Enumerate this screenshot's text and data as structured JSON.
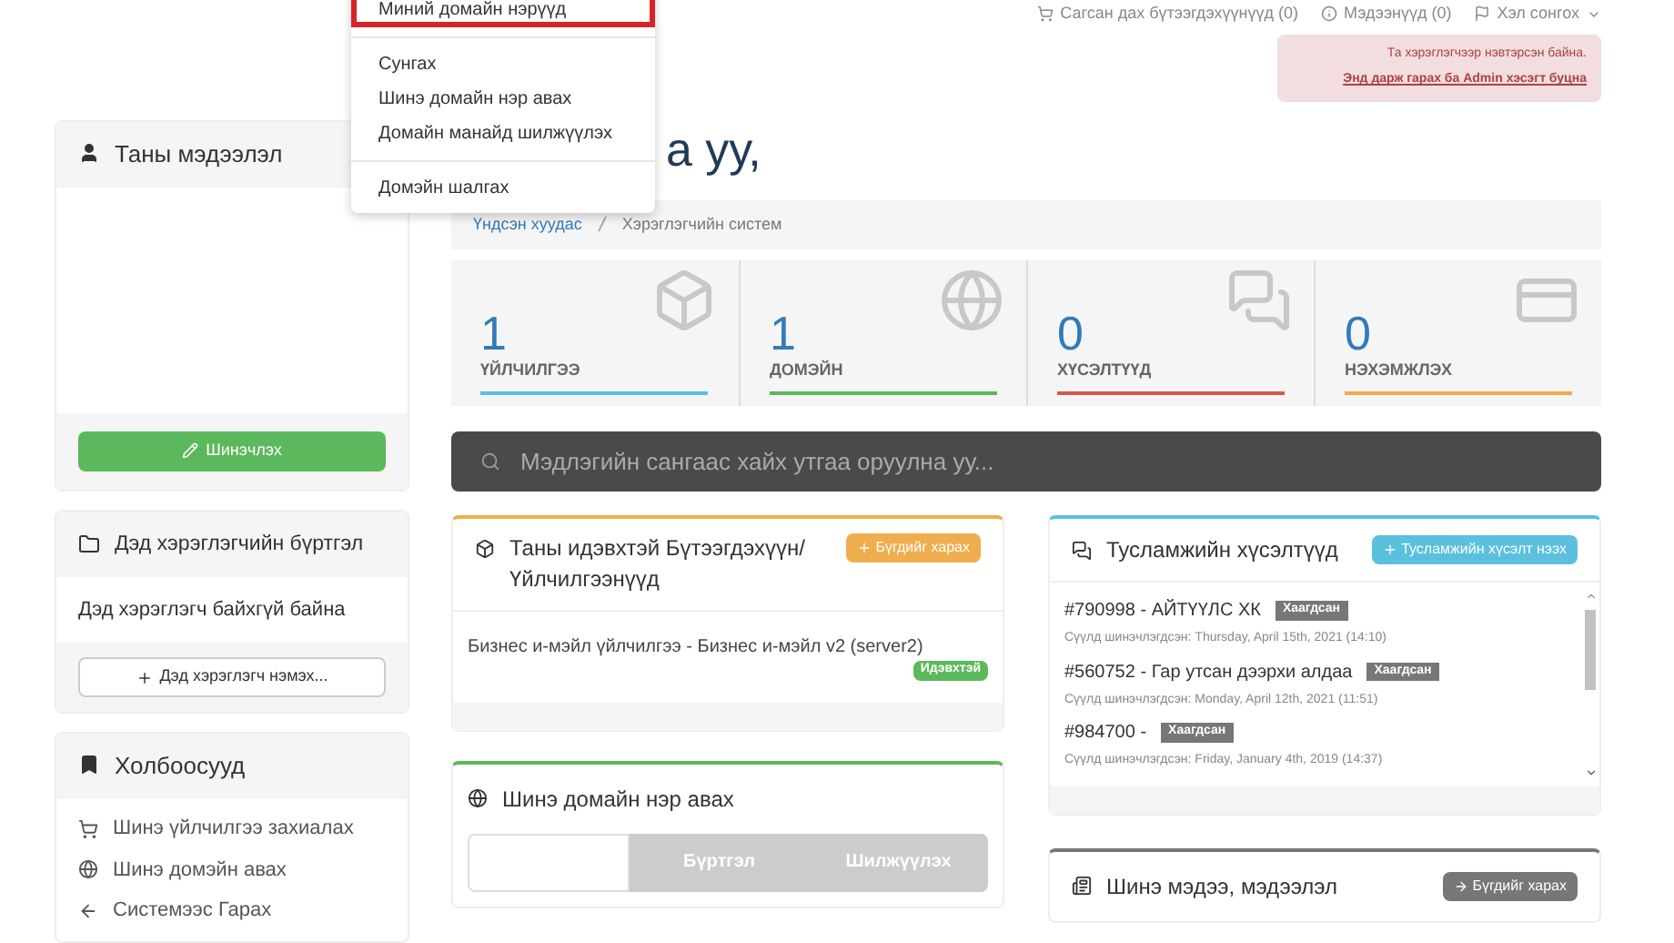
{
  "top_nav": [
    {
      "label": "Сагсан дах бүтээгдэхүүнүүд (0)"
    },
    {
      "label": "Мэдээнүүд (0)"
    },
    {
      "label": "Хэл сонгох"
    }
  ],
  "alert": {
    "message": "Та хэрэглэгчээр нэвтэрсэн байна.",
    "link": "Энд дарж гарах ба Admin хэсэгт буцна"
  },
  "dropdown": {
    "items": [
      {
        "kind": "item",
        "label": "Миний домайн нэрүүд",
        "highlighted": true
      },
      {
        "kind": "divider"
      },
      {
        "kind": "item",
        "label": "Сунгах",
        "highlighted": false
      },
      {
        "kind": "item",
        "label": "Шинэ домайн нэр авах",
        "highlighted": false
      },
      {
        "kind": "item",
        "label": "Домайн манайд шилжүүлэх",
        "highlighted": false
      },
      {
        "kind": "divider"
      },
      {
        "kind": "item",
        "label": "Домэйн шалгах",
        "highlighted": false
      }
    ]
  },
  "heading": "а уу,",
  "breadcrumb": [
    {
      "label": "Үндсэн хуудас"
    },
    {
      "label": "Хэрэглэгчийн систем"
    }
  ],
  "sidebar": {
    "profile": {
      "title": "Таны мэдээлэл",
      "button": "Шинэчлэх"
    },
    "subaccounts": {
      "title": "Дэд хэрэглэгчийн бүртгэл",
      "empty": "Дэд хэрэглэгч байхгүй байна",
      "button": "Дэд хэрэглэгч нэмэх..."
    },
    "links": {
      "title": "Холбоосууд",
      "items": [
        {
          "label": "Шинэ үйлчилгээ захиалах"
        },
        {
          "label": "Шинэ домэйн авах"
        },
        {
          "label": "Системээс Гарах"
        }
      ]
    }
  },
  "stats": [
    {
      "value": "1",
      "label": "ҮЙЛЧИЛГЭЭ",
      "color": "#5bc0de"
    },
    {
      "value": "1",
      "label": "ДОМЭЙН",
      "color": "#5cb85c"
    },
    {
      "value": "0",
      "label": "ХҮСЭЛТҮҮД",
      "color": "#d9534f"
    },
    {
      "value": "0",
      "label": "НЭХЭМЖЛЭХ",
      "color": "#f0ad4e"
    }
  ],
  "search": {
    "placeholder": "Мэдлэгийн сангаас хайх утгаа оруулна уу..."
  },
  "products_panel": {
    "title": "Таны идэвхтэй Бүтээгдэхүүн/ Үйлчилгээнүүд",
    "button": "Бүгдийг харах",
    "items": [
      {
        "name": "Бизнес и-мэйл үйлчилгээ - Бизнес и-мэйл v2 (server2)",
        "status": "Идэвхтэй"
      }
    ]
  },
  "domain_panel": {
    "title": "Шинэ домайн нэр авах",
    "buttons": [
      "Бүртгэл",
      "Шилжүүлэх"
    ]
  },
  "tickets_panel": {
    "title": "Тусламжийн хүсэлтүүд",
    "button": "Тусламжийн хүсэлт нээх",
    "tickets": [
      {
        "title": "#790998 - АЙТҮҮЛС ХК",
        "status": "Хаагдсан",
        "updated": "Сүүлд шинэчлэгдсэн: Thursday, April 15th, 2021 (14:10)"
      },
      {
        "title": "#560752 - Гар утсан дээрхи алдаа",
        "status": "Хаагдсан",
        "updated": "Сүүлд шинэчлэгдсэн: Monday, April 12th, 2021 (11:51)"
      },
      {
        "title": "#984700 -",
        "status": "Хаагдсан",
        "updated": "Сүүлд шинэчлэгдсэн: Friday, January 4th, 2019 (14:37)"
      }
    ]
  },
  "news_panel": {
    "title": "Шинэ мэдээ, мэдээлэл",
    "button": "Бүгдийг харах"
  }
}
